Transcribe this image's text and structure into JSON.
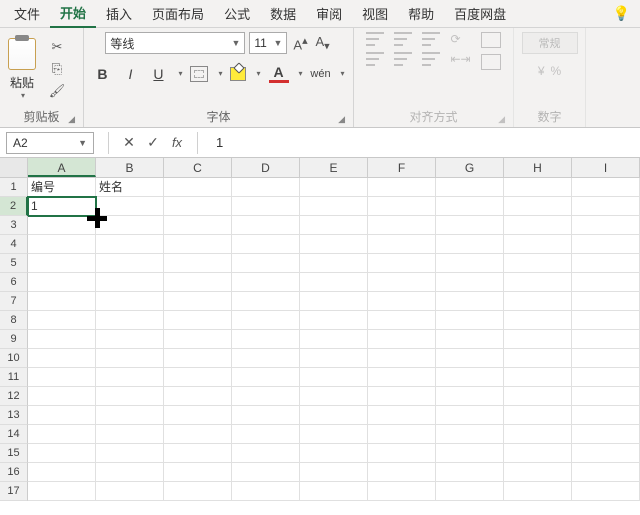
{
  "menu": {
    "items": [
      "文件",
      "开始",
      "插入",
      "页面布局",
      "公式",
      "数据",
      "审阅",
      "视图",
      "帮助",
      "百度网盘"
    ],
    "active_index": 1
  },
  "ribbon": {
    "clipboard": {
      "paste_label": "粘贴",
      "group_label": "剪贴板"
    },
    "font": {
      "name": "等线",
      "size": "11",
      "group_label": "字体",
      "bold": "B",
      "italic": "I",
      "underline": "U",
      "fontcolor": "A"
    },
    "alignment": {
      "group_label": "对齐方式"
    },
    "styles": {
      "normal": "常规"
    },
    "number": {
      "group_label": "数字"
    }
  },
  "formula_bar": {
    "namebox": "A2",
    "fx": "fx",
    "value": "1"
  },
  "grid": {
    "columns": [
      "A",
      "B",
      "C",
      "D",
      "E",
      "F",
      "G",
      "H",
      "I"
    ],
    "row_count": 17,
    "selected_cell": {
      "row": 2,
      "col": "A"
    },
    "cells": {
      "A1": "编号",
      "B1": "姓名",
      "A2": "1"
    }
  },
  "colors": {
    "accent": "#217346"
  }
}
